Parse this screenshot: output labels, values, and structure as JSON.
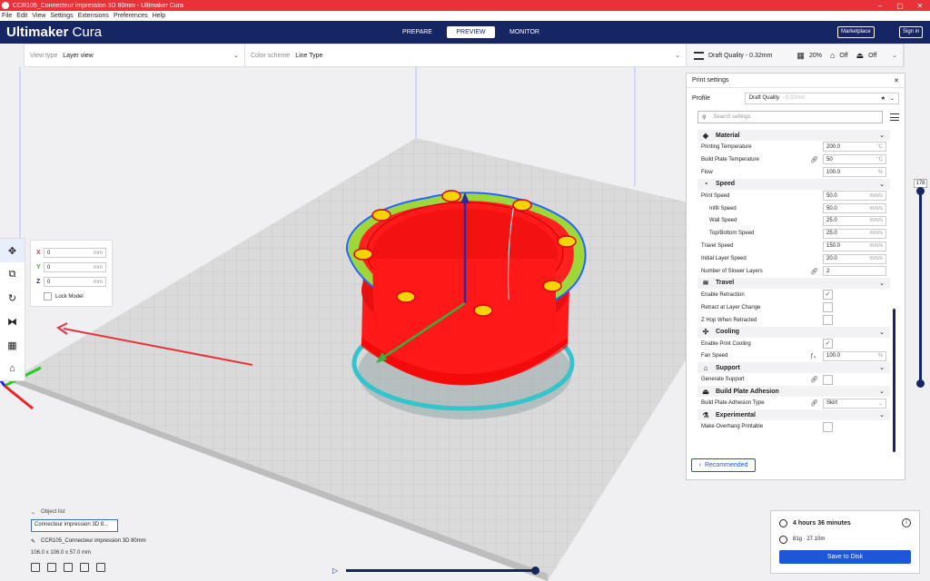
{
  "window": {
    "title": "CCR105_Connecteur impression 3D 80mm - Ultimaker Cura",
    "controls": [
      "–",
      "▢",
      "✕"
    ]
  },
  "menu": [
    "File",
    "Edit",
    "View",
    "Settings",
    "Extensions",
    "Preferences",
    "Help"
  ],
  "header": {
    "logo_bold": "Ultimaker",
    "logo_light": " Cura",
    "stages": [
      "PREPARE",
      "PREVIEW",
      "MONITOR"
    ],
    "active_stage": "PREVIEW",
    "marketplace": "Marketplace",
    "signin": "Sign in"
  },
  "controls": {
    "view_type_label": "View type",
    "view_type_value": "Layer view",
    "color_scheme_label": "Color scheme",
    "color_scheme_value": "Line Type",
    "quality": "Draft Quality - 0.32mm",
    "infill": "20%",
    "support": "Off",
    "adhesion": "Off"
  },
  "move_panel": {
    "x": "0",
    "y": "0",
    "z": "0",
    "unit": "mm",
    "lock_label": "Lock Model"
  },
  "settings": {
    "title": "Print settings",
    "profile_label": "Profile",
    "profile_value": "Draft Quality",
    "profile_suffix": "- 0.32mm",
    "search_placeholder": "Search settings",
    "categories": {
      "material": "Material",
      "speed": "Speed",
      "travel": "Travel",
      "cooling": "Cooling",
      "support": "Support",
      "adhesion": "Build Plate Adhesion",
      "experimental": "Experimental"
    },
    "rows": {
      "printing_temp": {
        "label": "Printing Temperature",
        "value": "200.0",
        "unit": "°C"
      },
      "bed_temp": {
        "label": "Build Plate Temperature",
        "value": "50",
        "unit": "°C"
      },
      "flow": {
        "label": "Flow",
        "value": "100.0",
        "unit": "%"
      },
      "print_speed": {
        "label": "Print Speed",
        "value": "50.0",
        "unit": "mm/s"
      },
      "infill_speed": {
        "label": "Infill Speed",
        "value": "50.0",
        "unit": "mm/s"
      },
      "wall_speed": {
        "label": "Wall Speed",
        "value": "25.0",
        "unit": "mm/s"
      },
      "topbottom_speed": {
        "label": "Top/Bottom Speed",
        "value": "25.0",
        "unit": "mm/s"
      },
      "travel_speed": {
        "label": "Travel Speed",
        "value": "150.0",
        "unit": "mm/s"
      },
      "initial_layer_speed": {
        "label": "Initial Layer Speed",
        "value": "20.0",
        "unit": "mm/s"
      },
      "slower_layers": {
        "label": "Number of Slower Layers",
        "value": "2",
        "unit": ""
      },
      "enable_retraction": {
        "label": "Enable Retraction"
      },
      "retract_layer_change": {
        "label": "Retract at Layer Change"
      },
      "z_hop": {
        "label": "Z Hop When Retracted"
      },
      "enable_cooling": {
        "label": "Enable Print Cooling"
      },
      "fan_speed": {
        "label": "Fan Speed",
        "value": "100.0",
        "unit": "%"
      },
      "generate_support": {
        "label": "Generate Support"
      },
      "adhesion_type": {
        "label": "Build Plate Adhesion Type",
        "value": "Skirt"
      },
      "overhang_printable": {
        "label": "Make Overhang Printable"
      }
    },
    "recommended": "Recommended"
  },
  "layer_slider": {
    "value": "178"
  },
  "objects": {
    "list_label": "Object list",
    "item": "Connecteur impression 3D 8...",
    "name": "CCR105_Connecteur impression 3D 80mm",
    "dims": "106.0 x 106.0 x 57.0 mm"
  },
  "print_info": {
    "time": "4 hours 36 minutes",
    "material": "81g · 27.10m",
    "save": "Save to Disk"
  },
  "colors": {
    "header": "#162563",
    "titlebar": "#e8323a",
    "accent": "#1f55d8",
    "model_wall": "#ff1a1a",
    "infill": "#9fd63a",
    "skirt": "#35c4cc"
  }
}
